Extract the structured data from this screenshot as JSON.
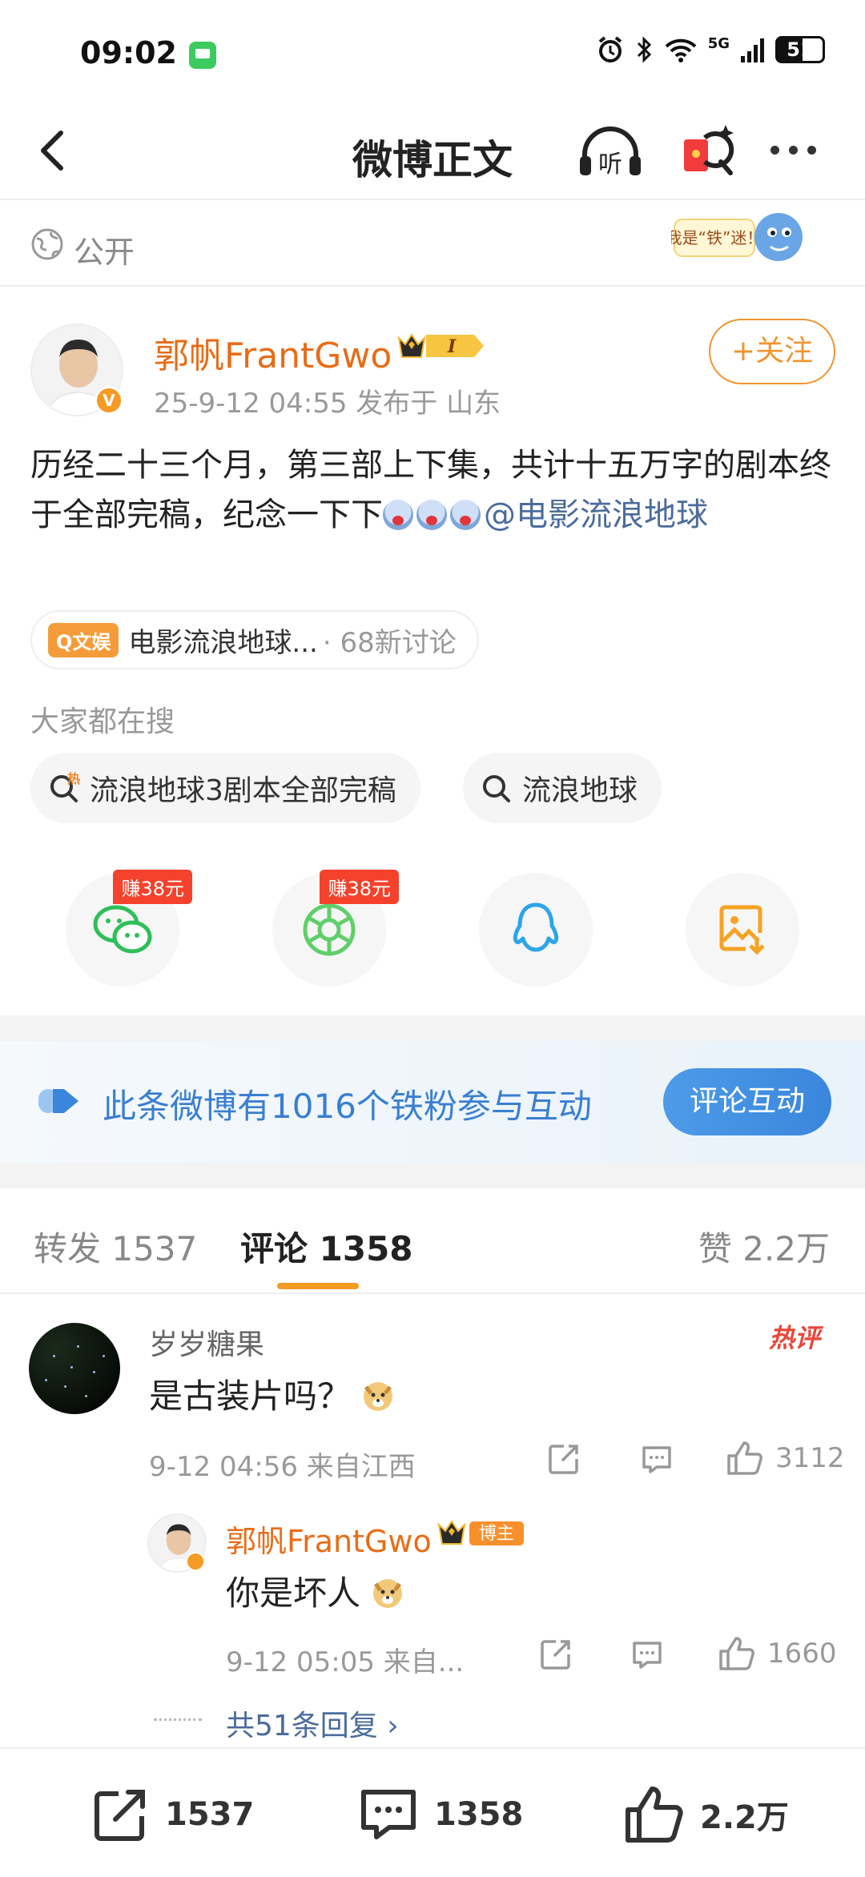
{
  "status_bar": {
    "time": "09:02",
    "network": "5G",
    "battery": "51"
  },
  "nav": {
    "title": "微博正文",
    "listen_label": "听"
  },
  "visibility": {
    "label": "公开",
    "sticker_text": "我是“铁”迷！"
  },
  "post": {
    "author": "郭帆FrantGwo",
    "crown_level": "I",
    "meta": "25-9-12 04:55  发布于 山东",
    "follow_label": "+关注",
    "text": "历经二十三个月，第三部上下集，共计十五万字的剧本终于全部完稿，纪念一下下",
    "mention": "@电影流浪地球",
    "topic": {
      "tag": "Q文娱",
      "name": "电影流浪地球...",
      "count": "· 68新讨论"
    }
  },
  "hot_search": {
    "label": "大家都在搜",
    "chips": [
      "流浪地球3剧本全部完稿",
      "流浪地球"
    ]
  },
  "share": {
    "earn_wechat": "赚38元",
    "earn_moments": "赚38元"
  },
  "fans_banner": {
    "text": "此条微博有1016个铁粉参与互动",
    "button": "评论互动"
  },
  "tabs": {
    "repost": "转发 1537",
    "comment": "评论 1358",
    "like": "赞 2.2万"
  },
  "comment": {
    "user": "岁岁糖果",
    "text": "是古装片吗？",
    "badge": "热评",
    "meta": "9-12 04:56  来自江西",
    "likes": "3112",
    "reply": {
      "user": "郭帆FrantGwo",
      "role": "博主",
      "text": "你是坏人",
      "meta": "9-12 05:05  来自...",
      "likes": "1660"
    },
    "more_replies": "共51条回复 ›"
  },
  "bottom_bar": {
    "reposts": "1537",
    "comments": "1358",
    "likes": "2.2万"
  },
  "colors": {
    "accent_orange": "#f0952f",
    "link_blue": "#4b6c9c",
    "banner_blue": "#3a7fd0"
  }
}
